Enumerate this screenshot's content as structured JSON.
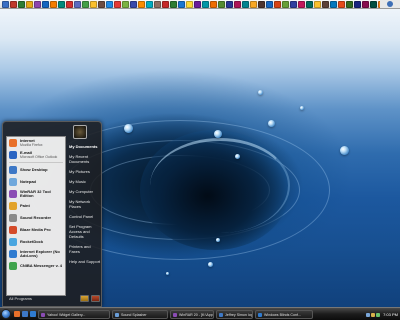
{
  "quicklaunch_icons": [
    "#3b6fc4",
    "#c0392b",
    "#2e7d32",
    "#e6a817",
    "#8e44ad",
    "#1565c0",
    "#f57c00",
    "#00897b",
    "#d32f2f",
    "#5c6bc0",
    "#43a047",
    "#fbc02d",
    "#6d4c41",
    "#1e88e5",
    "#e53935",
    "#7cb342",
    "#3949ab",
    "#fb8c00",
    "#00acc1",
    "#8d6e63",
    "#c62828",
    "#2e7d32",
    "#1976d2",
    "#fdd835",
    "#6a1b9a",
    "#0097a7",
    "#ef6c00",
    "#558b2f",
    "#283593",
    "#ad1457",
    "#00838f",
    "#f9a825",
    "#4e342e",
    "#1565c0",
    "#d84315",
    "#689f38",
    "#303f9f",
    "#c2185b",
    "#00695c",
    "#fbc02d",
    "#5d4037",
    "#0277bd",
    "#e64a19",
    "#33691e",
    "#1a237e",
    "#880e4f",
    "#004d40",
    "#f57f17",
    "#3e2723",
    "#01579b"
  ],
  "start_menu": {
    "pinned": [
      {
        "title": "Internet",
        "subtitle": "Mozilla Firefox",
        "icon": "firefox-icon",
        "color": "#e8702a"
      },
      {
        "title": "E-mail",
        "subtitle": "Microsoft Office Outlook",
        "icon": "outlook-icon",
        "color": "#2a64c2"
      }
    ],
    "recent": [
      {
        "label": "Show Desktop",
        "icon": "show-desktop-icon",
        "color": "#3d78c6"
      },
      {
        "label": "Notepad",
        "icon": "notepad-icon",
        "color": "#6fa8dc"
      },
      {
        "label": "WinRAR 32 Tool Edition",
        "icon": "winrar-icon",
        "color": "#8a4cb4"
      },
      {
        "label": "Paint",
        "icon": "paint-icon",
        "color": "#e2a22a"
      },
      {
        "label": "Sound Recorder",
        "icon": "sound-recorder-icon",
        "color": "#8a8a8a"
      },
      {
        "label": "Blaze Media Pro",
        "icon": "blaze-media-icon",
        "color": "#d44b2a"
      },
      {
        "label": "RocketDock",
        "icon": "rocketdock-icon",
        "color": "#4aa6e0"
      },
      {
        "label": "Internet Explorer (No Add-ons)",
        "icon": "ie-icon",
        "color": "#2f7bd0"
      },
      {
        "label": "CNIBA Messenger v. 4",
        "icon": "messenger-icon",
        "color": "#3fa34d"
      }
    ],
    "all_programs": "All Programs",
    "right": [
      {
        "label": "My Documents",
        "bold": true
      },
      {
        "label": "My Recent Documents",
        "bold": false
      },
      {
        "label": "My Pictures",
        "bold": false
      },
      {
        "label": "My Music",
        "bold": false
      },
      {
        "label": "My Computer",
        "bold": false
      },
      {
        "label": "My Network Places",
        "bold": false
      },
      {
        "label": "Control Panel",
        "bold": false
      },
      {
        "label": "Set Program Access and Defaults",
        "bold": false
      },
      {
        "label": "Printers and Faxes",
        "bold": false
      },
      {
        "label": "Help and Support",
        "bold": false
      }
    ]
  },
  "taskbar": {
    "buttons": [
      {
        "label": "Yahoo! Widget Gallery...",
        "color": "#8a4cb4"
      },
      {
        "label": "Sound Splasher",
        "color": "#6a9ed8"
      },
      {
        "label": "WinRAR 20 - [K:\\App...",
        "color": "#8a4cb4"
      },
      {
        "label": "Jeffrey Simon logo...",
        "color": "#3d78c6"
      },
      {
        "label": "Windows Blinds Conf...",
        "color": "#2f7bd0"
      }
    ],
    "clock": "7:03 PM"
  }
}
